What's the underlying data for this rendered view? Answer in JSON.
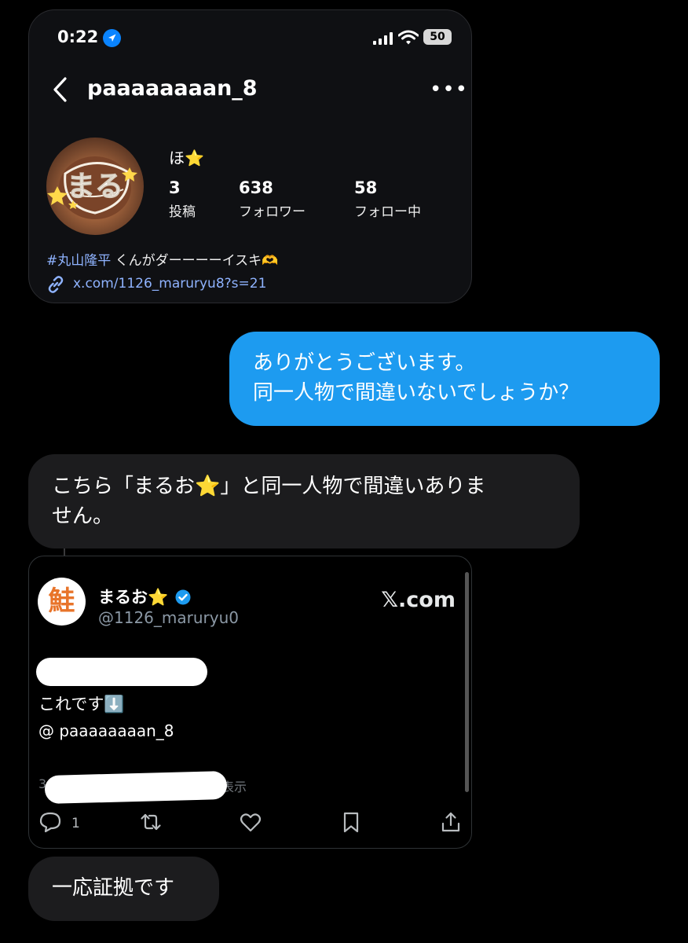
{
  "profile_screenshot": {
    "status_bar": {
      "time": "0:22",
      "battery": "50"
    },
    "username": "paaaaaaaan_8",
    "display_name": "ほ⭐",
    "avatar_text": "まる",
    "stats": [
      {
        "value": "3",
        "label": "投稿"
      },
      {
        "value": "638",
        "label": "フォロワー"
      },
      {
        "value": "58",
        "label": "フォロー中"
      }
    ],
    "bio_hashtag": "#丸山隆平",
    "bio_text": " くんがダーーーーイスキ🫶",
    "link": "x.com/1126_maruryu8?s=21"
  },
  "messages": {
    "outgoing_1": {
      "line1": "ありがとうございます。",
      "line2": "同一人物で間違いないでしょうか？"
    },
    "incoming_1": {
      "line1": "こちら「まるお⭐」と同一人物で間違いありま",
      "line2": "せん。"
    },
    "incoming_2": "一応証拠です"
  },
  "tweet_card": {
    "avatar_text": "鮭",
    "display_name": "まるお⭐",
    "handle": "@1126_maruryu0",
    "source": "𝕏.com",
    "text_line1": "これです⬇️",
    "text_line2": "@ paaaaaaaan_8",
    "meta_prefix": "3",
    "meta_suffix": "表示",
    "reply_count": "1"
  },
  "colors": {
    "accent_blue": "#1d9bf0",
    "incoming_bubble": "#1c1c1e",
    "link_blue": "#8fb3ff",
    "verified_blue": "#1d9bf0"
  }
}
